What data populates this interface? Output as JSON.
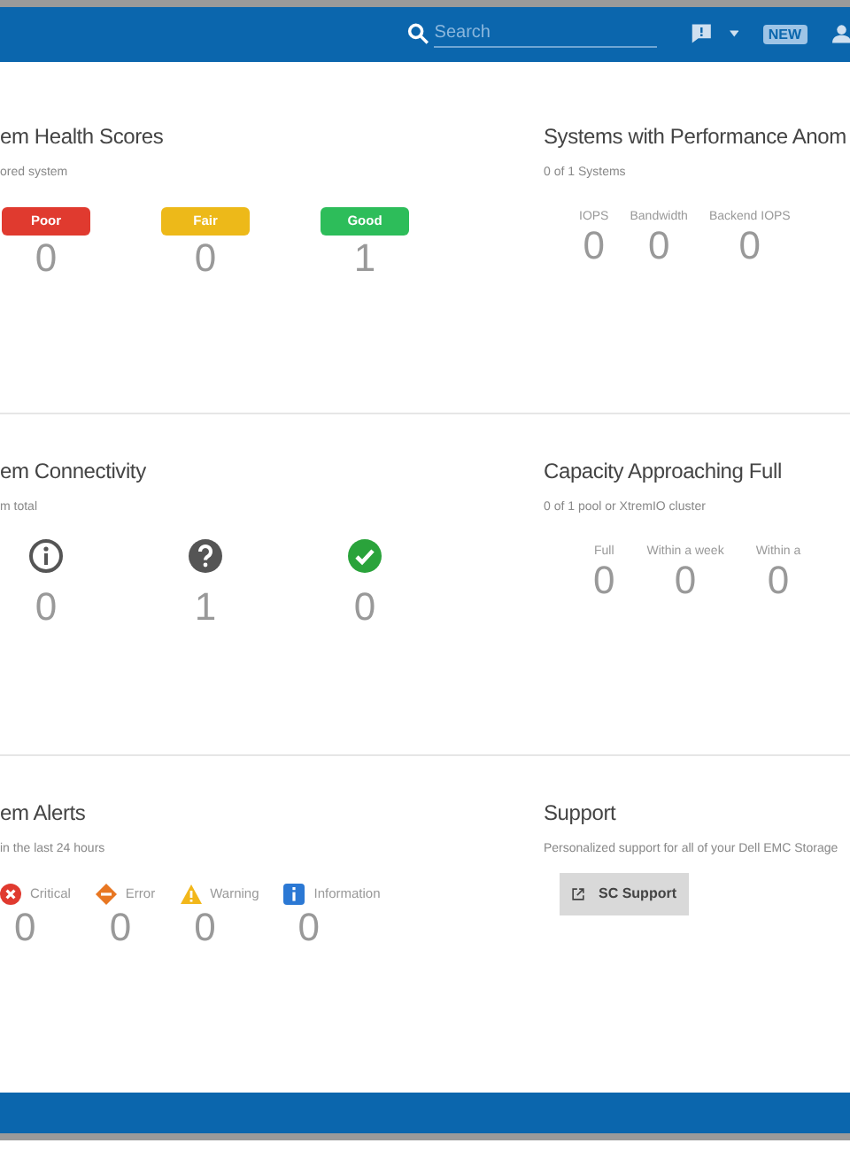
{
  "header": {
    "search": {
      "placeholder": "Search"
    },
    "new_badge": "NEW"
  },
  "health": {
    "title": "em Health Scores",
    "subtitle": "ored system",
    "items": [
      {
        "label": "Poor",
        "color": "#e03a2f",
        "value": "0"
      },
      {
        "label": "Fair",
        "color": "#edb919",
        "value": "0"
      },
      {
        "label": "Good",
        "color": "#2dbd5a",
        "value": "1"
      }
    ]
  },
  "performance": {
    "title": "Systems with Performance Anom",
    "subtitle": "0 of 1 Systems",
    "metrics": [
      {
        "label": "IOPS",
        "value": "0"
      },
      {
        "label": "Bandwidth",
        "value": "0"
      },
      {
        "label": "Backend IOPS",
        "value": "0"
      }
    ]
  },
  "connectivity": {
    "title": "em Connectivity",
    "subtitle": "m total",
    "items": [
      {
        "kind": "info",
        "value": "0"
      },
      {
        "kind": "unknown",
        "value": "1"
      },
      {
        "kind": "ok",
        "value": "0"
      }
    ]
  },
  "capacity": {
    "title": "Capacity Approaching Full",
    "subtitle": "0 of 1 pool or XtremIO cluster",
    "metrics": [
      {
        "label": "Full",
        "value": "0"
      },
      {
        "label": "Within a week",
        "value": "0"
      },
      {
        "label": "Within a",
        "value": "0"
      }
    ]
  },
  "alerts": {
    "title": "em Alerts",
    "subtitle": "in the last 24 hours",
    "items": [
      {
        "kind": "critical",
        "label": "Critical",
        "value": "0"
      },
      {
        "kind": "error",
        "label": "Error",
        "value": "0"
      },
      {
        "kind": "warning",
        "label": "Warning",
        "value": "0"
      },
      {
        "kind": "information",
        "label": "Information",
        "value": "0"
      }
    ]
  },
  "support": {
    "title": "Support",
    "subtitle": "Personalized support for all of your Dell EMC Storage",
    "button": "SC Support"
  }
}
